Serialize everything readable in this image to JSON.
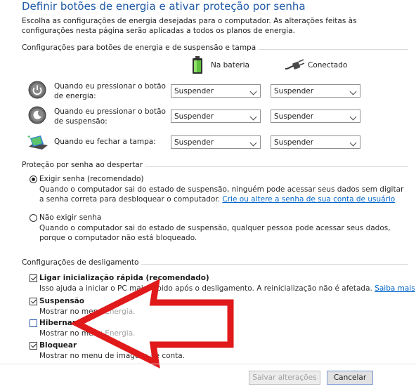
{
  "header": {
    "title": "Definir botões de energia e ativar proteção por senha",
    "description": "Escolha as configurações de energia desejadas para o computador. As alterações feitas às configurações nesta página serão aplicadas a todos os planos de energia."
  },
  "power_buttons": {
    "group_label": "Configurações para botões de energia e de suspensão e tampa",
    "col_battery": "Na bateria",
    "col_plugged": "Conectado",
    "rows": [
      {
        "label": "Quando eu pressionar o botão de energia:",
        "battery": "Suspender",
        "plugged": "Suspender",
        "icon": "power-button-icon"
      },
      {
        "label": "Quando eu pressionar o botão de suspensão:",
        "battery": "Suspender",
        "plugged": "Suspender",
        "icon": "sleep-button-icon"
      },
      {
        "label": "Quando eu fechar a tampa:",
        "battery": "Suspender",
        "plugged": "Suspender",
        "icon": "laptop-lid-icon"
      }
    ]
  },
  "password": {
    "group_label": "Proteção por senha ao despertar",
    "require_label": "Exigir senha (recomendado)",
    "require_desc_1": "Quando o computador sai do estado de suspensão, ninguém pode acessar seus dados sem digitar",
    "require_desc_2": "a senha correta para desbloquear o computador.",
    "require_link": "Crie ou altere a senha de sua conta de usuário",
    "norequire_label": "Não exigir senha",
    "norequire_desc_1": "Quando o computador sai do estado de suspensão, qualquer pessoa pode acessar seus dados,",
    "norequire_desc_2": "porque o computador não está bloqueado."
  },
  "shutdown": {
    "group_label": "Configurações de desligamento",
    "fast_startup_label": "Ligar inicialização rápida (recomendado)",
    "fast_startup_desc": "Isso ajuda a iniciar o PC mais rápido após o desligamento. A reinicialização não é afetada.",
    "fast_startup_link": "Saiba mais",
    "suspend_label": "Suspensão",
    "suspend_desc": "Mostrar no menu Energia.",
    "hibernate_label": "Hibernar",
    "hibernate_desc": "Mostrar no menu Energia.",
    "lock_label": "Bloquear",
    "lock_desc": "Mostrar no menu de imagens de conta."
  },
  "buttons": {
    "save": "Salvar alterações",
    "cancel": "Cancelar"
  },
  "colors": {
    "title": "#1f5aa6",
    "link": "#0066cc",
    "arrow_annotation": "#e0191b"
  }
}
